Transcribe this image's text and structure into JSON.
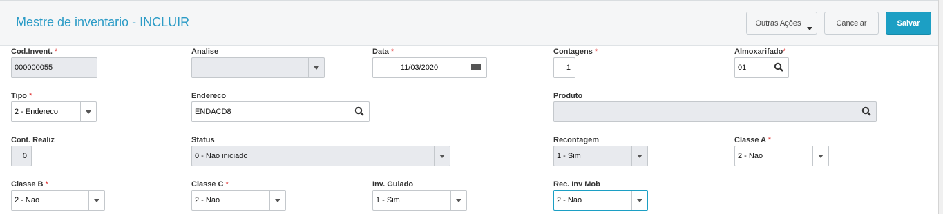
{
  "header": {
    "title": "Mestre de inventario - INCLUIR",
    "buttons": {
      "outras": "Outras Ações",
      "cancelar": "Cancelar",
      "salvar": "Salvar"
    }
  },
  "fields": {
    "cod": {
      "label": "Cod.Invent.",
      "value": "000000055"
    },
    "analise": {
      "label": "Analise",
      "value": ""
    },
    "data": {
      "label": "Data",
      "value": "11/03/2020"
    },
    "contagens": {
      "label": "Contagens",
      "value": "1"
    },
    "almox": {
      "label": "Almoxarifado",
      "value": "01"
    },
    "tipo": {
      "label": "Tipo",
      "value": "2 - Endereco"
    },
    "endereco": {
      "label": "Endereco",
      "value": "ENDACD8"
    },
    "produto": {
      "label": "Produto",
      "value": ""
    },
    "contrealiz": {
      "label": "Cont. Realiz",
      "value": "0"
    },
    "status": {
      "label": "Status",
      "value": "0 - Nao iniciado"
    },
    "recontagem": {
      "label": "Recontagem",
      "value": "1 - Sim"
    },
    "classea": {
      "label": "Classe A",
      "value": "2 - Nao"
    },
    "classeb": {
      "label": "Classe B",
      "value": "2 - Nao"
    },
    "classec": {
      "label": "Classe C",
      "value": "2 - Nao"
    },
    "invguiado": {
      "label": "Inv. Guiado",
      "value": "1 - Sim"
    },
    "recinvmob": {
      "label": "Rec. Inv Mob",
      "value": "2 - Nao"
    }
  },
  "required_mark": "*",
  "colors": {
    "accent": "#1c9fc4",
    "title": "#2b9bc6",
    "required": "#e03030",
    "readonly_bg": "#e8eaee"
  },
  "icons": [
    "search-icon",
    "calendar-icon",
    "chevron-down-icon"
  ]
}
